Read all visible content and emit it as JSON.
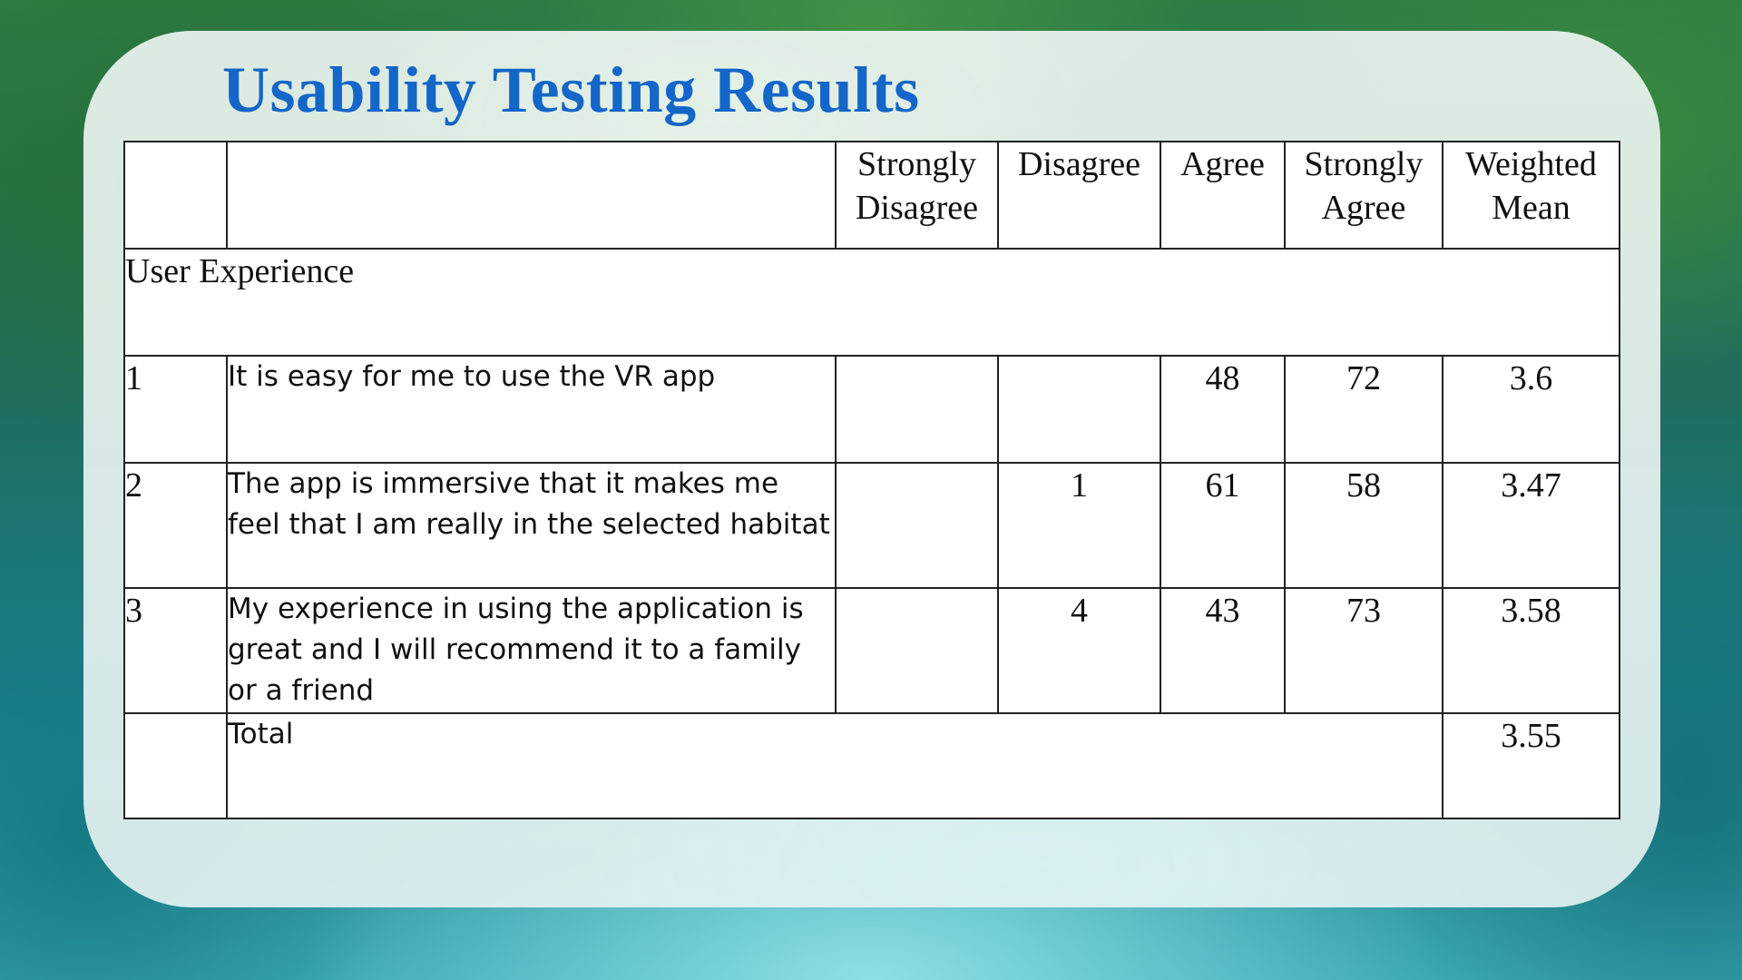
{
  "title": "Usability Testing Results",
  "colors": {
    "title": "#1466c8",
    "border": "#222222",
    "table_bg": "#ffffff"
  },
  "table": {
    "headers": {
      "index": "",
      "statement": "",
      "strongly_disagree": "Strongly Disagree",
      "disagree": "Disagree",
      "agree": "Agree",
      "strongly_agree": "Strongly Agree",
      "weighted_mean": "Weighted Mean"
    },
    "section": "User Experience",
    "rows": [
      {
        "index": "1",
        "statement": "It is easy for me to use the VR app",
        "strongly_disagree": "",
        "disagree": "",
        "agree": "48",
        "strongly_agree": "72",
        "weighted_mean": "3.6"
      },
      {
        "index": "2",
        "statement": "The app is immersive that it makes me feel that I am really in the selected habitat",
        "strongly_disagree": "",
        "disagree": "1",
        "agree": "61",
        "strongly_agree": "58",
        "weighted_mean": "3.47"
      },
      {
        "index": "3",
        "statement": "My experience in using the application is great and I will recommend it to a family or a friend",
        "strongly_disagree": "",
        "disagree": "4",
        "agree": "43",
        "strongly_agree": "73",
        "weighted_mean": "3.58"
      }
    ],
    "total": {
      "label": "Total",
      "weighted_mean": "3.55"
    }
  }
}
